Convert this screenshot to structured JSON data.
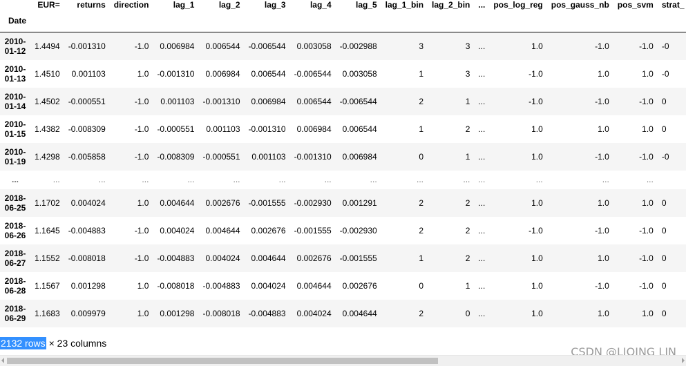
{
  "columns": [
    "EUR=",
    "returns",
    "direction",
    "lag_1",
    "lag_2",
    "lag_3",
    "lag_4",
    "lag_5",
    "lag_1_bin",
    "lag_2_bin",
    "...",
    "pos_log_reg",
    "pos_gauss_nb",
    "pos_svm",
    "strat_"
  ],
  "index_name": "Date",
  "rows": [
    {
      "date": [
        "2010-",
        "01-12"
      ],
      "cells": [
        "1.4494",
        "-0.001310",
        "-1.0",
        "0.006984",
        "0.006544",
        "-0.006544",
        "0.003058",
        "-0.002988",
        "3",
        "3",
        "...",
        "1.0",
        "-1.0",
        "-1.0",
        "-0"
      ]
    },
    {
      "date": [
        "2010-",
        "01-13"
      ],
      "cells": [
        "1.4510",
        "0.001103",
        "1.0",
        "-0.001310",
        "0.006984",
        "0.006544",
        "-0.006544",
        "0.003058",
        "1",
        "3",
        "...",
        "-1.0",
        "1.0",
        "1.0",
        "-0"
      ]
    },
    {
      "date": [
        "2010-",
        "01-14"
      ],
      "cells": [
        "1.4502",
        "-0.000551",
        "-1.0",
        "0.001103",
        "-0.001310",
        "0.006984",
        "0.006544",
        "-0.006544",
        "2",
        "1",
        "...",
        "-1.0",
        "-1.0",
        "-1.0",
        "0"
      ]
    },
    {
      "date": [
        "2010-",
        "01-15"
      ],
      "cells": [
        "1.4382",
        "-0.008309",
        "-1.0",
        "-0.000551",
        "0.001103",
        "-0.001310",
        "0.006984",
        "0.006544",
        "1",
        "2",
        "...",
        "1.0",
        "1.0",
        "1.0",
        "0"
      ]
    },
    {
      "date": [
        "2010-",
        "01-19"
      ],
      "cells": [
        "1.4298",
        "-0.005858",
        "-1.0",
        "-0.008309",
        "-0.000551",
        "0.001103",
        "-0.001310",
        "0.006984",
        "0",
        "1",
        "...",
        "1.0",
        "-1.0",
        "-1.0",
        "-0"
      ]
    },
    {
      "date": [
        "...",
        ""
      ],
      "ellipsis": true,
      "cells": [
        "...",
        "...",
        "...",
        "...",
        "...",
        "...",
        "...",
        "...",
        "...",
        "...",
        "...",
        "...",
        "...",
        "...",
        ""
      ]
    },
    {
      "date": [
        "2018-",
        "06-25"
      ],
      "cells": [
        "1.1702",
        "0.004024",
        "1.0",
        "0.004644",
        "0.002676",
        "-0.001555",
        "-0.002930",
        "0.001291",
        "2",
        "2",
        "...",
        "1.0",
        "1.0",
        "1.0",
        "0"
      ]
    },
    {
      "date": [
        "2018-",
        "06-26"
      ],
      "cells": [
        "1.1645",
        "-0.004883",
        "-1.0",
        "0.004024",
        "0.004644",
        "0.002676",
        "-0.001555",
        "-0.002930",
        "2",
        "2",
        "...",
        "-1.0",
        "-1.0",
        "-1.0",
        "0"
      ]
    },
    {
      "date": [
        "2018-",
        "06-27"
      ],
      "cells": [
        "1.1552",
        "-0.008018",
        "-1.0",
        "-0.004883",
        "0.004024",
        "0.004644",
        "0.002676",
        "-0.001555",
        "1",
        "2",
        "...",
        "1.0",
        "1.0",
        "-1.0",
        "0"
      ]
    },
    {
      "date": [
        "2018-",
        "06-28"
      ],
      "cells": [
        "1.1567",
        "0.001298",
        "1.0",
        "-0.008018",
        "-0.004883",
        "0.004024",
        "0.004644",
        "0.002676",
        "0",
        "1",
        "...",
        "1.0",
        "-1.0",
        "-1.0",
        "0"
      ]
    },
    {
      "date": [
        "2018-",
        "06-29"
      ],
      "cells": [
        "1.1683",
        "0.009979",
        "1.0",
        "0.001298",
        "-0.008018",
        "-0.004883",
        "0.004024",
        "0.004644",
        "2",
        "0",
        "...",
        "1.0",
        "1.0",
        "1.0",
        "0"
      ]
    }
  ],
  "footer": {
    "rows_text": "2132 rows",
    "cols_text": "× 23 columns"
  },
  "watermark": "CSDN @LIQING LIN"
}
